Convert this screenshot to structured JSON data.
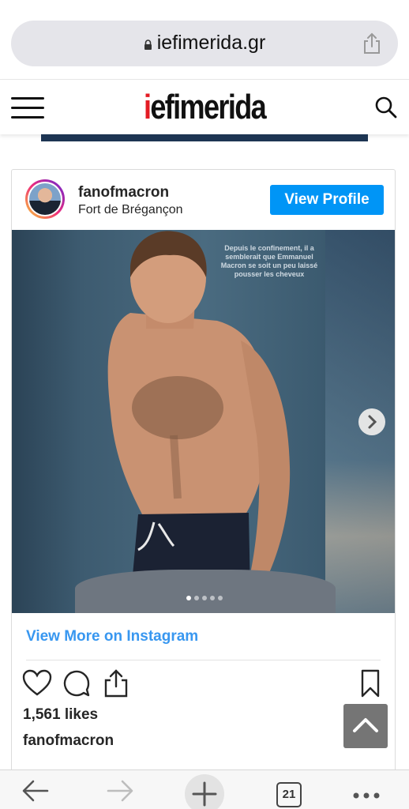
{
  "browser": {
    "url": "iefimerida.gr",
    "tabs_count": "21"
  },
  "site": {
    "logo_prefix": "i",
    "logo_rest": "efimerida"
  },
  "instagram": {
    "username": "fanofmacron",
    "location": "Fort de Brégançon",
    "view_profile_label": "View Profile",
    "photo_overlay_text": "Depuis le confinement, il a semblerait que Emmanuel Macron se soit un peu laissé pousser les cheveux",
    "carousel": {
      "total_slides": 5,
      "active_slide": 1
    },
    "view_more_label": "View More on Instagram",
    "likes": "1,561 likes",
    "caption_username": "fanofmacron"
  },
  "icons": {
    "lock": "lock-icon",
    "share": "share-icon",
    "menu": "hamburger-menu-icon",
    "search": "search-icon",
    "next": "chevron-right-icon",
    "like": "heart-icon",
    "comment": "comment-icon",
    "send": "share-icon",
    "save": "bookmark-icon",
    "scroll_top": "chevron-up-icon",
    "back": "back-arrow-icon",
    "forward": "forward-arrow-icon",
    "new_tab": "plus-icon",
    "tabs": "tabs-icon",
    "more": "more-icon"
  },
  "colors": {
    "brand_red": "#e31b23",
    "instagram_blue": "#0095f6",
    "link_blue": "#3897f0"
  }
}
